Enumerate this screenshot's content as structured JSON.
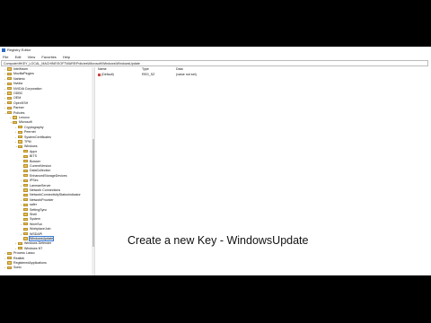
{
  "window": {
    "title": "Registry Editor",
    "menu": [
      "File",
      "Edit",
      "View",
      "Favorites",
      "Help"
    ],
    "address": "Computer\\HKEY_LOCAL_MACHINE\\SOFTWARE\\Policies\\Microsoft\\Windows\\WindowsUpdate"
  },
  "tree": {
    "items": [
      {
        "label": "IntelHaxm",
        "indent": 0,
        "expander": ">"
      },
      {
        "label": "MozillaPlugins",
        "indent": 0,
        "expander": ">"
      },
      {
        "label": "Nahimic",
        "indent": 0,
        "expander": ">"
      },
      {
        "label": "Nvidia",
        "indent": 0,
        "expander": ">"
      },
      {
        "label": "NVIDIA Corporation",
        "indent": 0,
        "expander": ">"
      },
      {
        "label": "ODBC",
        "indent": 0,
        "expander": ">"
      },
      {
        "label": "OEM",
        "indent": 0,
        "expander": ">"
      },
      {
        "label": "OpenSSH",
        "indent": 0,
        "expander": ">"
      },
      {
        "label": "Partner",
        "indent": 0,
        "expander": ">"
      },
      {
        "label": "Policies",
        "indent": 0,
        "expander": "v"
      },
      {
        "label": "Lenovo",
        "indent": 1,
        "expander": ">"
      },
      {
        "label": "Microsoft",
        "indent": 1,
        "expander": "v"
      },
      {
        "label": "Cryptography",
        "indent": 2,
        "expander": ">"
      },
      {
        "label": "Peernet",
        "indent": 2,
        "expander": ">"
      },
      {
        "label": "SystemCertificates",
        "indent": 2,
        "expander": ">"
      },
      {
        "label": "TPM",
        "indent": 2,
        "expander": ">"
      },
      {
        "label": "Windows",
        "indent": 2,
        "expander": "v"
      },
      {
        "label": "Appx",
        "indent": 3,
        "expander": ""
      },
      {
        "label": "BITS",
        "indent": 3,
        "expander": ""
      },
      {
        "label": "Bowser",
        "indent": 3,
        "expander": ""
      },
      {
        "label": "CurrentVersion",
        "indent": 3,
        "expander": ""
      },
      {
        "label": "DataCollection",
        "indent": 3,
        "expander": ""
      },
      {
        "label": "EnhancedStorageDevices",
        "indent": 3,
        "expander": ""
      },
      {
        "label": "IPSec",
        "indent": 3,
        "expander": ">"
      },
      {
        "label": "LanmanServer",
        "indent": 3,
        "expander": ">"
      },
      {
        "label": "Network Connections",
        "indent": 3,
        "expander": ""
      },
      {
        "label": "NetworkConnectivityStatusIndicator",
        "indent": 3,
        "expander": ""
      },
      {
        "label": "NetworkProvider",
        "indent": 3,
        "expander": ">"
      },
      {
        "label": "safer",
        "indent": 3,
        "expander": ">"
      },
      {
        "label": "SettingSync",
        "indent": 3,
        "expander": ""
      },
      {
        "label": "Shell",
        "indent": 3,
        "expander": ""
      },
      {
        "label": "System",
        "indent": 3,
        "expander": ""
      },
      {
        "label": "WcmSvc",
        "indent": 3,
        "expander": ">"
      },
      {
        "label": "WorkplaceJoin",
        "indent": 3,
        "expander": ""
      },
      {
        "label": "WSDAPI",
        "indent": 3,
        "expander": ">"
      },
      {
        "label": "WindowsUpdate",
        "indent": 3,
        "expander": "",
        "selected": true
      },
      {
        "label": "Windows Defender",
        "indent": 2,
        "expander": ">"
      },
      {
        "label": "Windows NT",
        "indent": 2,
        "expander": ">"
      },
      {
        "label": "Process Lasso",
        "indent": 0,
        "expander": ">"
      },
      {
        "label": "Realtek",
        "indent": 0,
        "expander": ">"
      },
      {
        "label": "RegisteredApplications",
        "indent": 0,
        "expander": ""
      },
      {
        "label": "Sonic",
        "indent": 0,
        "expander": ">"
      }
    ]
  },
  "values": {
    "headers": [
      "Name",
      "Type",
      "Data"
    ],
    "rows": [
      {
        "name": "(Default)",
        "type": "REG_SZ",
        "data": "(value not set)"
      }
    ]
  },
  "caption": "Create a new Key - WindowsUpdate",
  "colors": {
    "accent": "#3a7bd5",
    "folder": "#e8c15a",
    "letterbox": "#000000"
  }
}
